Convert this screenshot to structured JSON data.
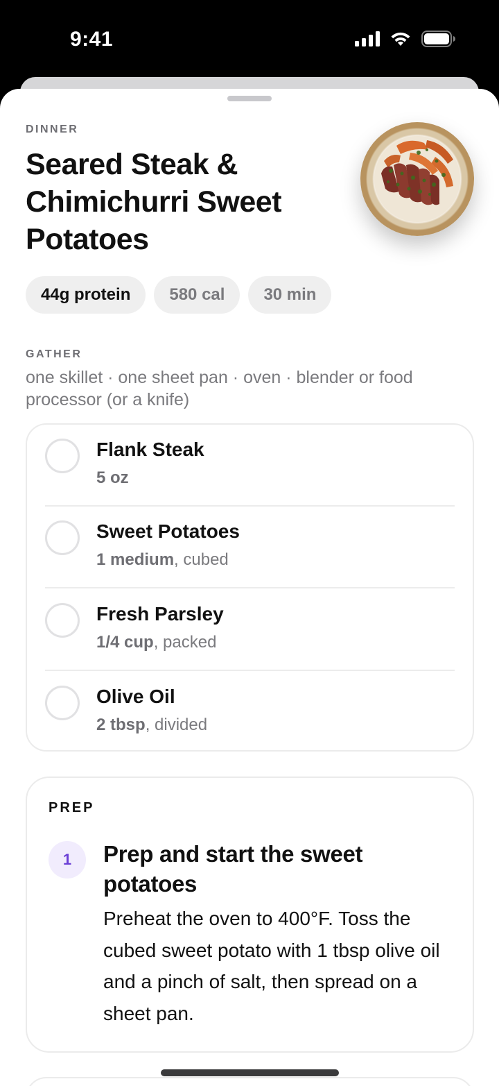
{
  "status_bar": {
    "time": "9:41"
  },
  "recipe": {
    "meal_type": "DINNER",
    "title": "Seared Steak & Chimichurri Sweet Potatoes",
    "image_icon": "dish-photo",
    "chips": [
      {
        "label": "44g protein"
      },
      {
        "label": "580 cal"
      },
      {
        "label": "30 min"
      }
    ]
  },
  "gather": {
    "label": "GATHER",
    "equipment": "one skillet · one sheet pan · oven · blender or food processor (or a knife)"
  },
  "ingredients": [
    {
      "name": "Flank Steak",
      "qty": "5 oz",
      "note": ""
    },
    {
      "name": "Sweet Potatoes",
      "qty": "1 medium",
      "note": ", cubed"
    },
    {
      "name": "Fresh Parsley",
      "qty": "1/4 cup",
      "note": ", packed"
    },
    {
      "name": "Olive Oil",
      "qty": "2 tbsp",
      "note": ", divided"
    }
  ],
  "prep": {
    "label": "PREP",
    "steps": [
      {
        "number": "1",
        "title": "Prep and start the sweet potatoes",
        "body": "Preheat the oven to 400°F. Toss the cubed sweet potato with 1 tbsp olive oil and a pinch of salt, then spread on a sheet pan."
      }
    ]
  },
  "colors": {
    "accent": "#6b3fd6",
    "accent_bg": "#f1ecfd",
    "muted_text": "#7a7a7e",
    "chip_bg": "#efefef"
  }
}
